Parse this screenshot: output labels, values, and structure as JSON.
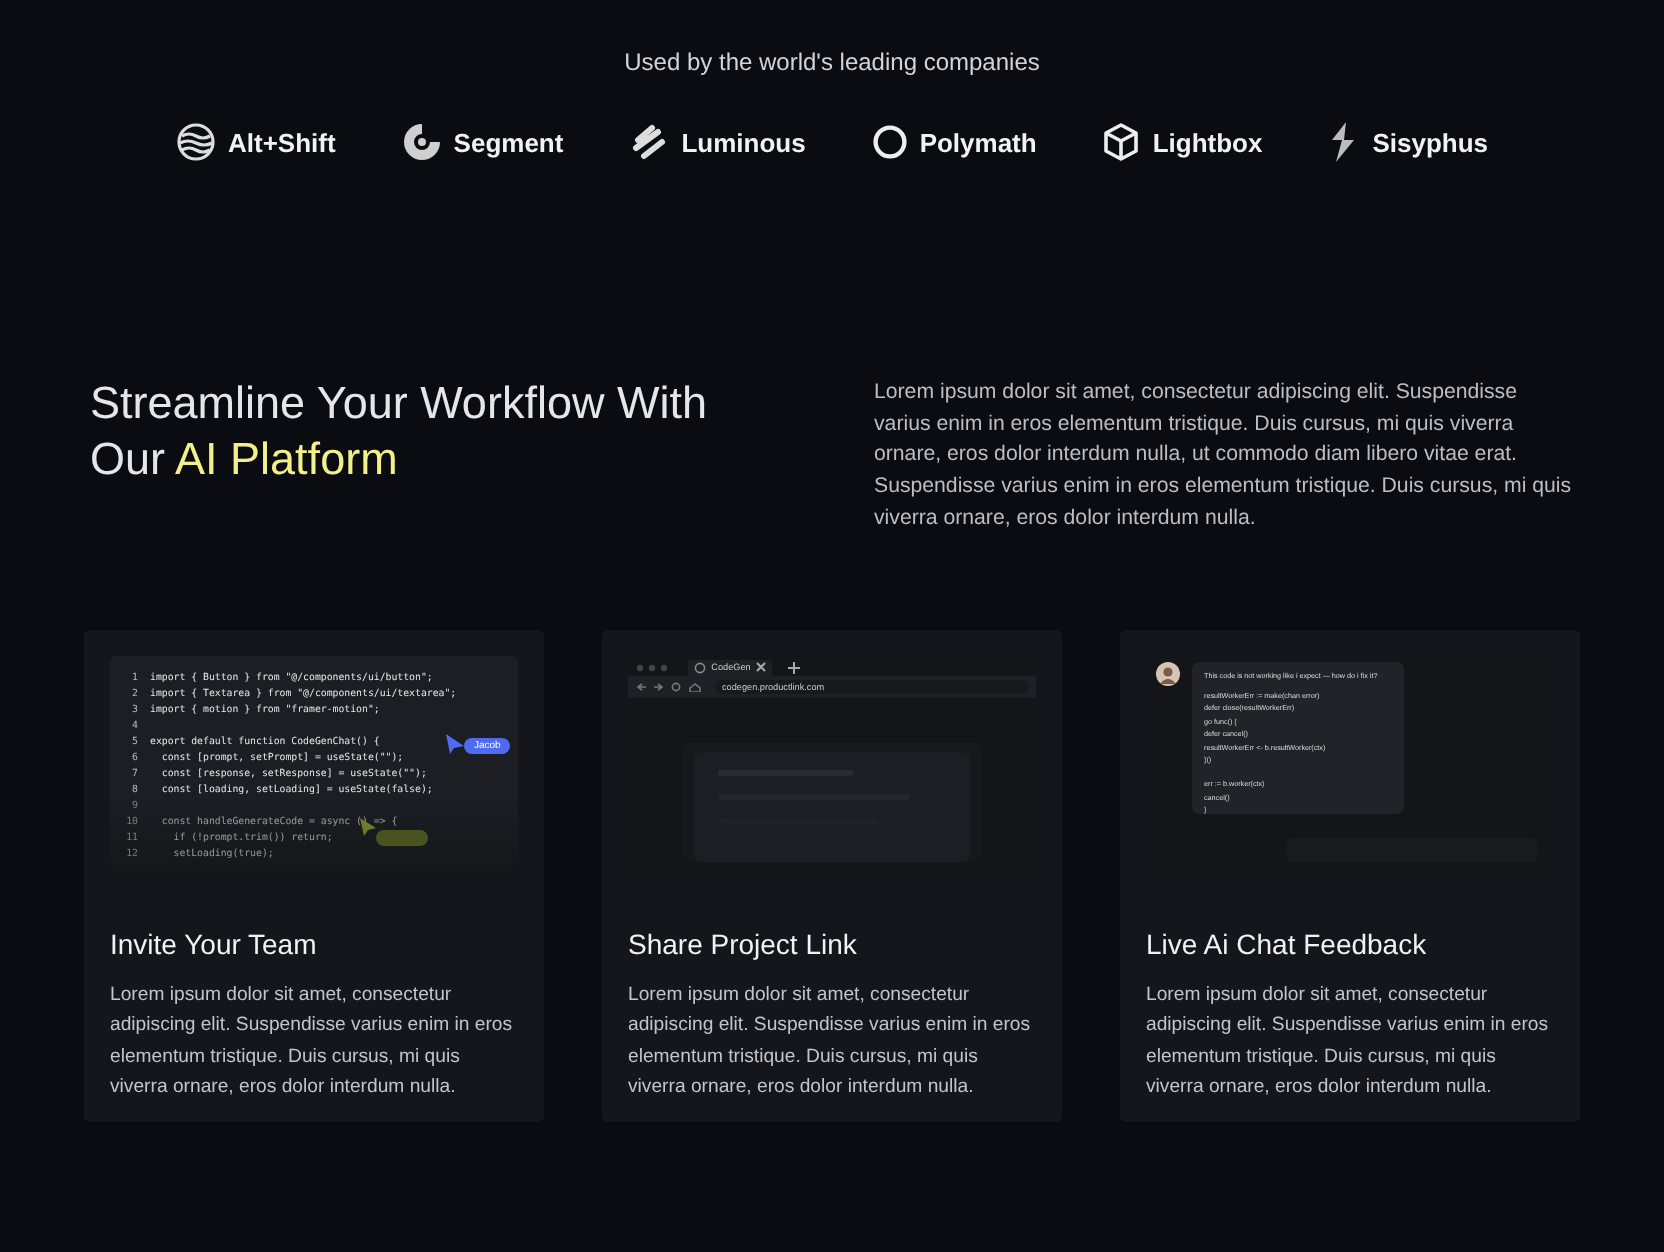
{
  "companies": {
    "caption": "Used by the world's leading companies",
    "logos": [
      {
        "name": "Alt+Shift",
        "kind": "waves"
      },
      {
        "name": "Segment",
        "kind": "segment"
      },
      {
        "name": "Luminous",
        "kind": "stripes"
      },
      {
        "name": "Polymath",
        "kind": "ring"
      },
      {
        "name": "Lightbox",
        "kind": "cube"
      },
      {
        "name": "Sisyphus",
        "kind": "bolt"
      }
    ]
  },
  "hero": {
    "heading_start": "Streamline Your Workflow With Our",
    "heading_highlight": "AI Platform",
    "description": "Lorem ipsum dolor sit amet, consectetur adipiscing elit. Suspendisse varius enim in eros elementum tristique. Duis cursus, mi quis viverra ornare, eros dolor interdum nulla, ut commodo diam libero vitae erat. Suspendisse varius enim in eros elementum tristique. Duis cursus, mi quis viverra ornare, eros dolor interdum nulla."
  },
  "features": [
    {
      "title": "Invite Your Team",
      "text": "Lorem ipsum dolor sit amet, consectetur adipiscing elit. Suspendisse varius enim in eros elementum tristique. Duis cursus, mi quis viverra ornare, eros dolor interdum nulla.",
      "preview": {
        "kind": "code",
        "cursor_label": "Jacob",
        "lines": [
          {
            "number": "1",
            "code": "import { Button } from \"@/components/ui/button\";",
            "faded": false
          },
          {
            "number": "2",
            "code": "import { Textarea } from \"@/components/ui/textarea\";",
            "faded": false
          },
          {
            "number": "3",
            "code": "import { motion } from \"framer-motion\";",
            "faded": false
          },
          {
            "number": "4",
            "faded": false
          },
          {
            "number": "5",
            "code": "export default function CodeGenChat() {",
            "faded": false
          },
          {
            "number": "6",
            "code": "  const [prompt, setPrompt] = useState(\"\");",
            "faded": false
          },
          {
            "number": "7",
            "code": "  const [response, setResponse] = useState(\"\");",
            "faded": false
          },
          {
            "number": "8",
            "code": "  const [loading, setLoading] = useState(false);",
            "faded": false
          },
          {
            "number": "9",
            "faded": true
          },
          {
            "number": "10",
            "code": "  const handleGenerateCode = async () => {",
            "faded": true
          },
          {
            "number": "11",
            "code": "    if (!prompt.trim()) return;",
            "faded": true
          },
          {
            "number": "12",
            "code": "    setLoading(true);",
            "faded": true
          }
        ]
      }
    },
    {
      "title": "Share Project Link",
      "text": "Lorem ipsum dolor sit amet, consectetur adipiscing elit. Suspendisse varius enim in eros elementum tristique. Duis cursus, mi quis viverra ornare, eros dolor interdum nulla.",
      "preview": {
        "kind": "browser",
        "tab": "CodeGen",
        "url": "codegen.productlink.com"
      }
    },
    {
      "title": "Live Ai Chat Feedback",
      "text": "Lorem ipsum dolor sit amet, consectetur adipiscing elit. Suspendisse varius enim in eros elementum tristique. Duis cursus, mi quis viverra ornare, eros dolor interdum nulla.",
      "preview": {
        "kind": "chat",
        "message": "This code is not working like i expect — how do i fix it?",
        "code": [
          "resultWorkerErr := make(chan error)",
          "defer close(resultWorkerErr)",
          "go func() {",
          " defer cancel()",
          " resultWorkerErr <- b.resultWorker(ctx)",
          "}()"
        ],
        "code_after": [
          "err := b.worker(ctx)",
          "cancel()",
          "}"
        ]
      }
    }
  ]
}
